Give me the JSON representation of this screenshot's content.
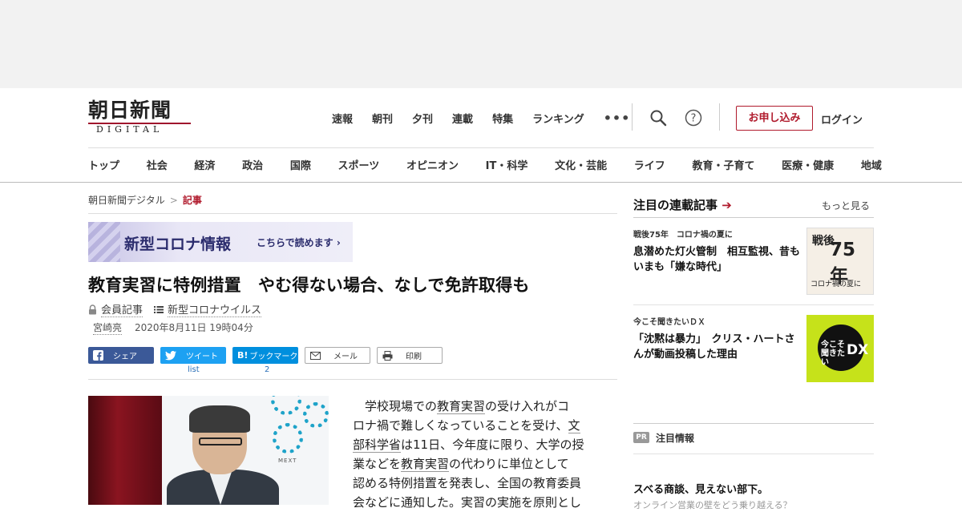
{
  "header": {
    "logo_title": "朝日新聞",
    "logo_sub": "DIGITAL",
    "top_nav": [
      "速報",
      "朝刊",
      "夕刊",
      "連載",
      "特集",
      "ランキング"
    ],
    "more": "•••",
    "apply_label": "お申し込み",
    "login_label": "ログイン",
    "categories": [
      "トップ",
      "社会",
      "経済",
      "政治",
      "国際",
      "スポーツ",
      "オピニオン",
      "IT・科学",
      "文化・芸能",
      "ライフ",
      "教育・子育て",
      "医療・健康",
      "地域"
    ]
  },
  "breadcrumb": {
    "home": "朝日新聞デジタル",
    "sep": ">",
    "current": "記事"
  },
  "banner": {
    "title": "新型コロナ情報",
    "link": "こちらで読めます ›"
  },
  "article": {
    "headline": "教育実習に特例措置　やむ得ない場合、なしで免許取得も",
    "member_label": "会員記事",
    "topic_label": "新型コロナウイルス",
    "author": "宮崎亮",
    "datetime": "2020年8月11日 19時04分",
    "body_l1a": "　学校現場での",
    "body_kw1": "教育実習",
    "body_l1b": "の受け入れがコ",
    "body_l2": "ロナ禍で難しくなっていることを受け、",
    "body_kw2a": "文",
    "body_kw2b": "部科学省",
    "body_l3": "は11日、今年度に限り、大学の授",
    "body_l4a": "業などを",
    "body_kw3": "教育実習",
    "body_l4b": "の代わりに単位として",
    "body_l5": "認める特例措置を発表し、全国の教育委員",
    "body_l6": "会などに通知した。実習の実施を原則とし",
    "photo_text": "MEXT"
  },
  "share": {
    "facebook": "シェア",
    "twitter": "ツイート",
    "twitter_count": "list",
    "hatena": "ブックマーク",
    "hatena_prefix": "B!",
    "hatena_count": "2",
    "mail": "メール",
    "print": "印刷"
  },
  "sidebar": {
    "heading": "注目の連載記事",
    "arrow": "➔",
    "more": "もっと見る",
    "items": [
      {
        "series": "戦後75年　コロナ禍の夏に",
        "title": "息潜めた灯火管制　相互監視、昔もいまも「嫌な時代」",
        "thumb_a": "戦後",
        "thumb_b": "75年",
        "thumb_c": "コロナ禍の夏に"
      },
      {
        "series": "今こそ聞きたいＤＸ",
        "title": "「沈黙は暴力」　クリス・ハートさんが動画投稿した理由",
        "thumb_t": "今こそ聞きたい",
        "thumb_dx": "DX"
      }
    ],
    "pr_badge": "PR",
    "pr_label": "注目情報",
    "pr_title": "スベる商談、見えない部下。",
    "pr_sub": "オンライン営業の壁をどう乗り越える？"
  }
}
